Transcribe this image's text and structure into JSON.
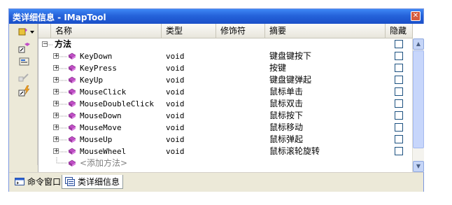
{
  "window": {
    "title": "类详细信息 - IMapTool"
  },
  "columns": [
    {
      "label": "名称"
    },
    {
      "label": "类型"
    },
    {
      "label": "修饰符"
    },
    {
      "label": "摘要"
    },
    {
      "label": "隐藏"
    }
  ],
  "group": {
    "label": "方法"
  },
  "methods": [
    {
      "name": "KeyDown",
      "type": "void",
      "modifier": "",
      "summary": "键盘键按下",
      "hidden": false
    },
    {
      "name": "KeyPress",
      "type": "void",
      "modifier": "",
      "summary": "按键",
      "hidden": false
    },
    {
      "name": "KeyUp",
      "type": "void",
      "modifier": "",
      "summary": "键盘键弹起",
      "hidden": false
    },
    {
      "name": "MouseClick",
      "type": "void",
      "modifier": "",
      "summary": "鼠标单击",
      "hidden": false
    },
    {
      "name": "MouseDoubleClick",
      "type": "void",
      "modifier": "",
      "summary": "鼠标双击",
      "hidden": false
    },
    {
      "name": "MouseDown",
      "type": "void",
      "modifier": "",
      "summary": "鼠标按下",
      "hidden": false
    },
    {
      "name": "MouseMove",
      "type": "void",
      "modifier": "",
      "summary": "鼠标移动",
      "hidden": false
    },
    {
      "name": "MouseUp",
      "type": "void",
      "modifier": "",
      "summary": "鼠标弹起",
      "hidden": false
    },
    {
      "name": "MouseWheel",
      "type": "void",
      "modifier": "",
      "summary": "鼠标滚轮旋转",
      "hidden": false
    }
  ],
  "add_method": {
    "label": "<添加方法>"
  },
  "tabs": [
    {
      "label": "命令窗口",
      "icon": "command-window-icon"
    },
    {
      "label": "类详细信息",
      "icon": "class-details-icon"
    }
  ],
  "toolbar_icons": [
    "new-member-icon",
    "class-icon",
    "properties-icon",
    "disabled-icon",
    "event-icon"
  ],
  "colors": {
    "titlebar": "#2563da",
    "method_icon": "#c14dc6",
    "window_bg": "#ece9d8"
  }
}
